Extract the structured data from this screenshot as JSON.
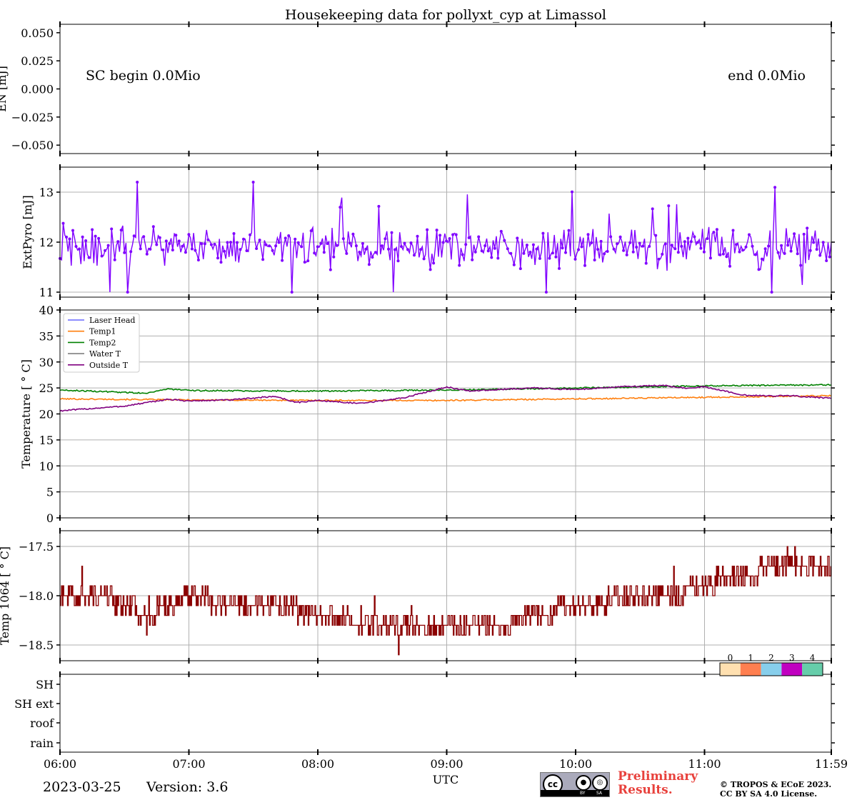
{
  "title": "Housekeeping data for pollyxt_cyp at Limassol",
  "footer": {
    "date": "2023-03-25",
    "version": "Version: 3.6",
    "license_badge": {
      "cc": "cc",
      "by": "BY",
      "sa": "SA"
    },
    "preliminary": [
      "Preliminary",
      "Results."
    ],
    "copyright": [
      "© TROPOS & ECoE 2023.",
      "CC BY SA 4.0 License."
    ]
  },
  "colors": {
    "extpyro": "#8000ff",
    "laser_head": "#6666ff",
    "temp1": "#ff7f0e",
    "temp2": "#008000",
    "water_t": "#808080",
    "outside_t": "#800080",
    "temp1064": "#8b0000",
    "grid": "#b0b0b0"
  },
  "chart_data": [
    {
      "type": "line",
      "panel": "EN",
      "ylabel": "EN [mJ]",
      "ylim": [
        -0.0575,
        0.0575
      ],
      "yticks": [
        0.05,
        0.025,
        0.0,
        -0.025,
        -0.05
      ],
      "ytick_labels": [
        "0.050",
        "0.025",
        "0.000",
        "−0.025",
        "−0.050"
      ],
      "grid": false,
      "annotations": [
        "SC begin 0.0Mio",
        "end 0.0Mio"
      ],
      "series": []
    },
    {
      "type": "line",
      "panel": "ExtPyro",
      "ylabel": "ExtPyro [mJ]",
      "ylim": [
        10.9,
        13.5
      ],
      "yticks": [
        11,
        12,
        13
      ],
      "ytick_labels": [
        "11",
        "12",
        "13"
      ],
      "grid": true,
      "series": [
        {
          "color": "#8000ff",
          "x_range": [
            "06:00",
            "11:59"
          ],
          "n": 480,
          "baseline": 11.9,
          "noise": 0.3,
          "min": 11.0,
          "max": 13.2,
          "markers": true
        }
      ]
    },
    {
      "type": "line",
      "panel": "Temperature",
      "ylabel": "Temperature [$^\\circ C$]",
      "ylim": [
        0,
        40
      ],
      "yticks": [
        0,
        5,
        10,
        15,
        20,
        25,
        30,
        35,
        40
      ],
      "ytick_labels": [
        "0",
        "5",
        "10",
        "15",
        "20",
        "25",
        "30",
        "35",
        "40"
      ],
      "grid": true,
      "legend_position": "top-left",
      "series": [
        {
          "name": "Laser Head",
          "color": "#6666ff",
          "x": [],
          "y": []
        },
        {
          "name": "Temp1",
          "color": "#ff7f0e",
          "x": [
            "06:00",
            "07:00",
            "08:00",
            "09:00",
            "10:00",
            "11:00",
            "11:59"
          ],
          "y": [
            22.9,
            22.7,
            22.6,
            22.6,
            22.9,
            23.2,
            23.5
          ]
        },
        {
          "name": "Temp2",
          "color": "#008000",
          "x": [
            "06:00",
            "06:40",
            "06:50",
            "07:00",
            "08:00",
            "09:00",
            "10:00",
            "11:00",
            "11:59"
          ],
          "y": [
            24.6,
            24.0,
            24.8,
            24.5,
            24.4,
            24.6,
            25.0,
            25.4,
            25.6
          ]
        },
        {
          "name": "Water T",
          "color": "#808080",
          "x": [],
          "y": []
        },
        {
          "name": "Outside T",
          "color": "#800080",
          "x": [
            "06:00",
            "06:30",
            "06:50",
            "07:00",
            "07:20",
            "07:40",
            "07:50",
            "08:00",
            "08:20",
            "08:40",
            "09:00",
            "09:10",
            "09:20",
            "09:40",
            "10:00",
            "10:20",
            "10:40",
            "10:50",
            "11:00",
            "11:20",
            "11:40",
            "11:59"
          ],
          "y": [
            20.6,
            21.5,
            22.8,
            22.5,
            22.7,
            23.4,
            22.2,
            22.6,
            22.0,
            23.1,
            25.2,
            24.4,
            24.6,
            25.0,
            24.7,
            25.2,
            25.5,
            25.0,
            25.2,
            23.5,
            23.5,
            23.0
          ]
        }
      ]
    },
    {
      "type": "line",
      "panel": "Temp 1064",
      "ylabel": "Temp 1064 [$^\\circ C$]",
      "ylim": [
        -18.66,
        -17.34
      ],
      "yticks": [
        -17.5,
        -18.0,
        -18.5
      ],
      "ytick_labels": [
        "−17.5",
        "−18.0",
        "−18.5"
      ],
      "grid": true,
      "series": [
        {
          "color": "#8b0000",
          "step": 0.1,
          "x": [
            "06:00",
            "06:20",
            "06:30",
            "06:40",
            "07:00",
            "07:20",
            "07:40",
            "08:00",
            "08:30",
            "08:50",
            "09:00",
            "09:20",
            "09:40",
            "10:00",
            "10:30",
            "10:40",
            "11:00",
            "11:10",
            "11:20",
            "11:30",
            "11:40",
            "11:59"
          ],
          "y": [
            -18.0,
            -18.0,
            -18.1,
            -18.2,
            -18.0,
            -18.1,
            -18.1,
            -18.2,
            -18.3,
            -18.3,
            -18.3,
            -18.3,
            -18.2,
            -18.1,
            -18.0,
            -18.0,
            -17.9,
            -17.8,
            -17.8,
            -17.7,
            -17.7,
            -17.7
          ]
        }
      ]
    },
    {
      "type": "heatmap",
      "panel": "status",
      "ytick_labels": [
        "SH",
        "SH ext",
        "roof",
        "rain"
      ],
      "colorbar": {
        "labels": [
          "0",
          "1",
          "2",
          "3",
          "4"
        ],
        "colors": [
          "#ffe0b0",
          "#ff7f50",
          "#87ceeb",
          "#c000c0",
          "#66cdaa"
        ]
      },
      "xlabel": "UTC",
      "xtick_labels": [
        "06:00",
        "07:00",
        "08:00",
        "09:00",
        "10:00",
        "11:00",
        "11:59"
      ],
      "values": []
    }
  ]
}
